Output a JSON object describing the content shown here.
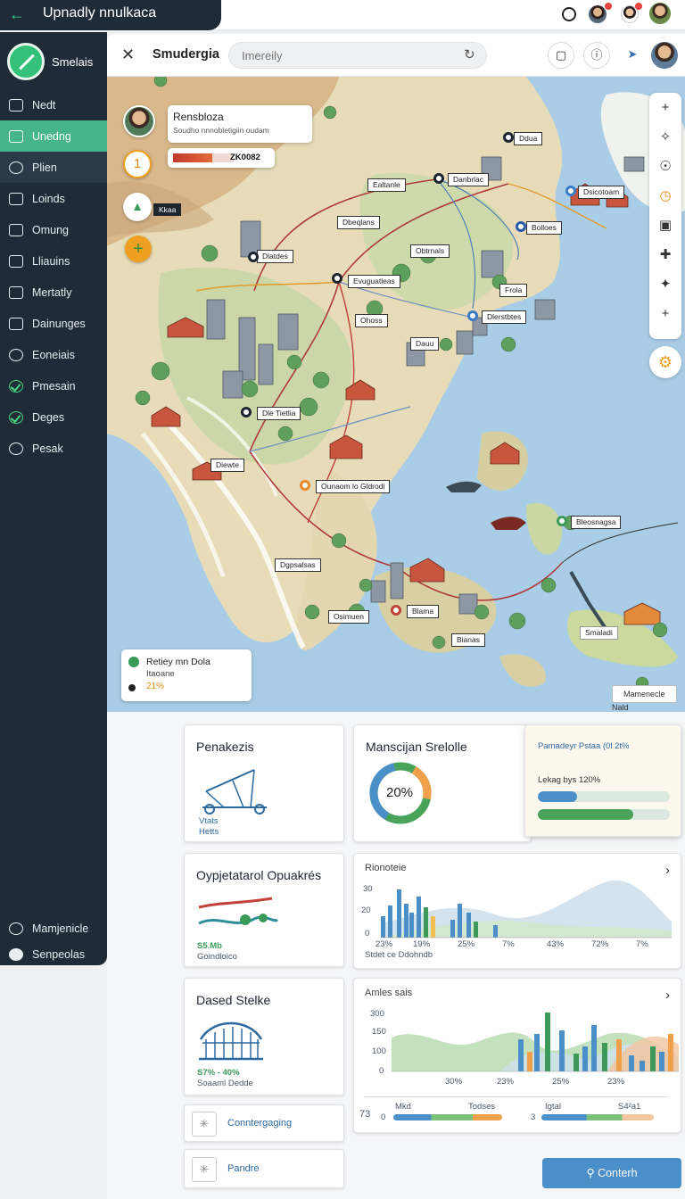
{
  "app": {
    "title": "Upnadly nnulkaca"
  },
  "sidebar": {
    "brand": "Smelais",
    "items": [
      {
        "label": "Nedt",
        "icon": "panel-icon"
      },
      {
        "label": "Unedng",
        "icon": "layers-icon"
      },
      {
        "label": "Plien",
        "icon": "user-icon"
      },
      {
        "label": "Loinds",
        "icon": "panel-icon"
      },
      {
        "label": "Omung",
        "icon": "square-icon"
      },
      {
        "label": "Lliauins",
        "icon": "panel-icon"
      },
      {
        "label": "Mertatly",
        "icon": "square-icon"
      },
      {
        "label": "Dainunges",
        "icon": "panel-icon"
      },
      {
        "label": "Eoneiais",
        "icon": "info-icon"
      },
      {
        "label": "Pmesain",
        "icon": "check-icon"
      },
      {
        "label": "Deges",
        "icon": "check-icon"
      },
      {
        "label": "Pesak",
        "icon": "close-icon"
      }
    ],
    "bottom": [
      {
        "label": "Mamjenicle",
        "icon": "globe-icon"
      },
      {
        "label": "Senpeolas",
        "icon": "users-icon"
      }
    ]
  },
  "map_header": {
    "title": "Smudergia",
    "search_placeholder": "Imereily"
  },
  "map_overlay": {
    "profile_name": "Rensbloza",
    "profile_sub": "Soudho nnnobletigiin oudam",
    "progress_label": "ZK0082",
    "progress_fraction": 0.64,
    "side_badge_number": "1",
    "side_badge_label": "Kkaa",
    "legend_title": "Retiey mn Dola",
    "legend_sub": "Itaoane",
    "legend_value": "21%",
    "scale_label": "Mamenecle",
    "map_footer": "Nald"
  },
  "map_labels": [
    "Ddua",
    "Danbrlac",
    "Ealtanle",
    "Dsicotoam",
    "Dbeqlans",
    "Bolloes",
    "Dlatdes",
    "Evuguatleas",
    "Frola",
    "Ohoss",
    "Dlerstbtes",
    "Dauu",
    "Dle Tietlia",
    "Diewte",
    "Ounaom lo Gldrodi",
    "Bleosnagsa",
    "Dgpsalsas",
    "Osimuen",
    "Blama",
    "Bianas",
    "Smaladi",
    "Obtrnals"
  ],
  "dashboard": {
    "card1": {
      "title": "Penakezis",
      "line1": "Vtats",
      "line2": "Hetts"
    },
    "card2": {
      "title": "Manscijan Srelolle",
      "donut_value": "20%",
      "donut_fraction": 0.2
    },
    "card3": {
      "title": "Pamadeyr Pstaa (0l 2t%",
      "bar_label": "Lekag bys 120%",
      "bar1_fraction": 0.3,
      "bar2_fraction": 0.72
    },
    "card4": {
      "title": "Oypjetatarol Opuakrés",
      "value": "S5.Mb",
      "sub": "Goindloico"
    },
    "card5": {
      "title": "Rionoteie",
      "y_labels": [
        "30",
        "20",
        "0"
      ],
      "x_labels": [
        "23%",
        "19%",
        "25%",
        "7%",
        "43%",
        "72%",
        "7%"
      ],
      "footer": "Stdet ce Ddohndb"
    },
    "card6": {
      "title": "Dased Stelke",
      "value": "S7% - 40%",
      "sub": "Soaaml Dedde"
    },
    "card7": {
      "title": "Amles sais",
      "y_labels": [
        "300",
        "150",
        "100",
        "0"
      ],
      "x_labels": [
        "30%",
        "23%",
        "25%",
        "23%"
      ],
      "legend": [
        "Mkd",
        "Todses",
        "Igtal",
        "S4²a1"
      ],
      "side_numbers": [
        "73",
        "0",
        "3"
      ]
    },
    "link1": "Conntergaging",
    "link2": "Pandre",
    "contact_button": "Conterh"
  },
  "colors": {
    "sidebar": "#1f2c38",
    "accent": "#46b58b",
    "water": "#a9cde6",
    "land": "#e7dcb7",
    "route": "#b03a3a",
    "button": "#4b8fc8"
  }
}
